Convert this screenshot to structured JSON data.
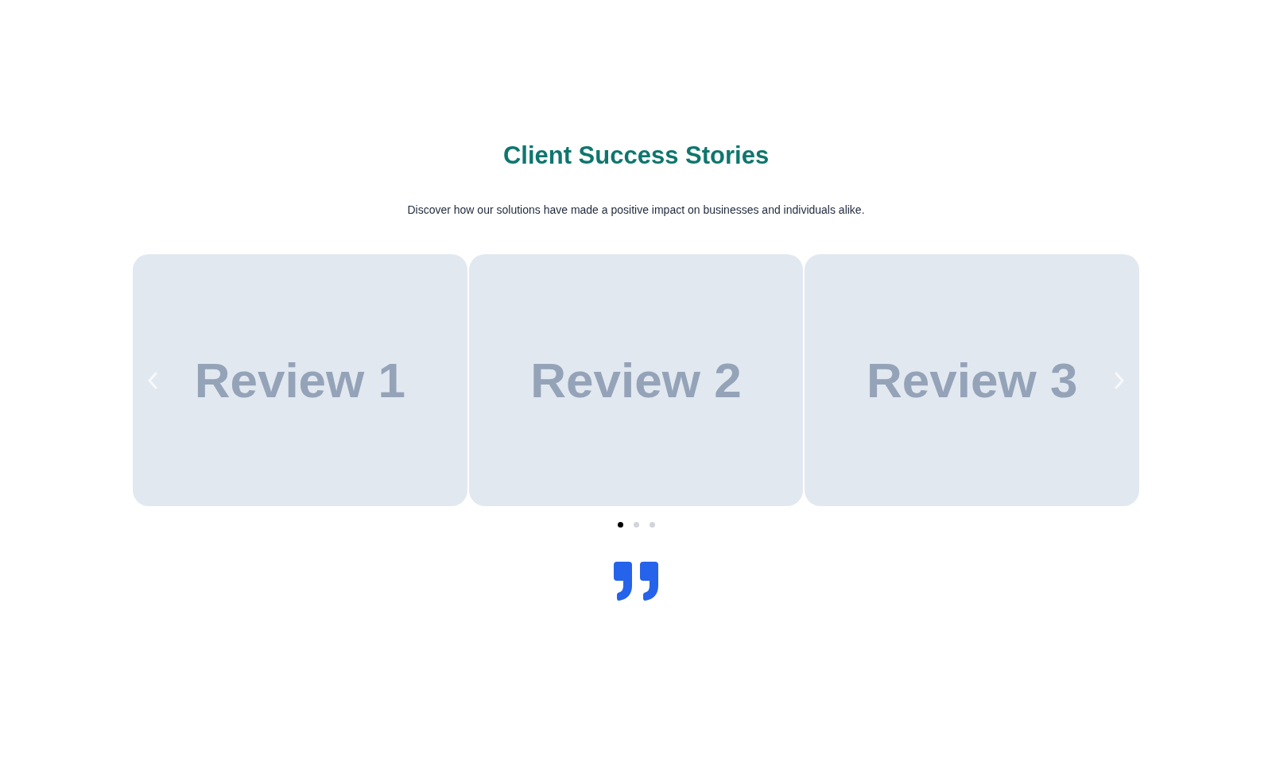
{
  "section": {
    "title": "Client Success Stories",
    "subtitle": "Discover how our solutions have made a positive impact on businesses and individuals alike."
  },
  "carousel": {
    "slides": [
      {
        "label": "Review 1"
      },
      {
        "label": "Review 2"
      },
      {
        "label": "Review 3"
      }
    ],
    "dots": [
      {
        "selected": true
      },
      {
        "selected": false
      },
      {
        "selected": false
      }
    ]
  }
}
